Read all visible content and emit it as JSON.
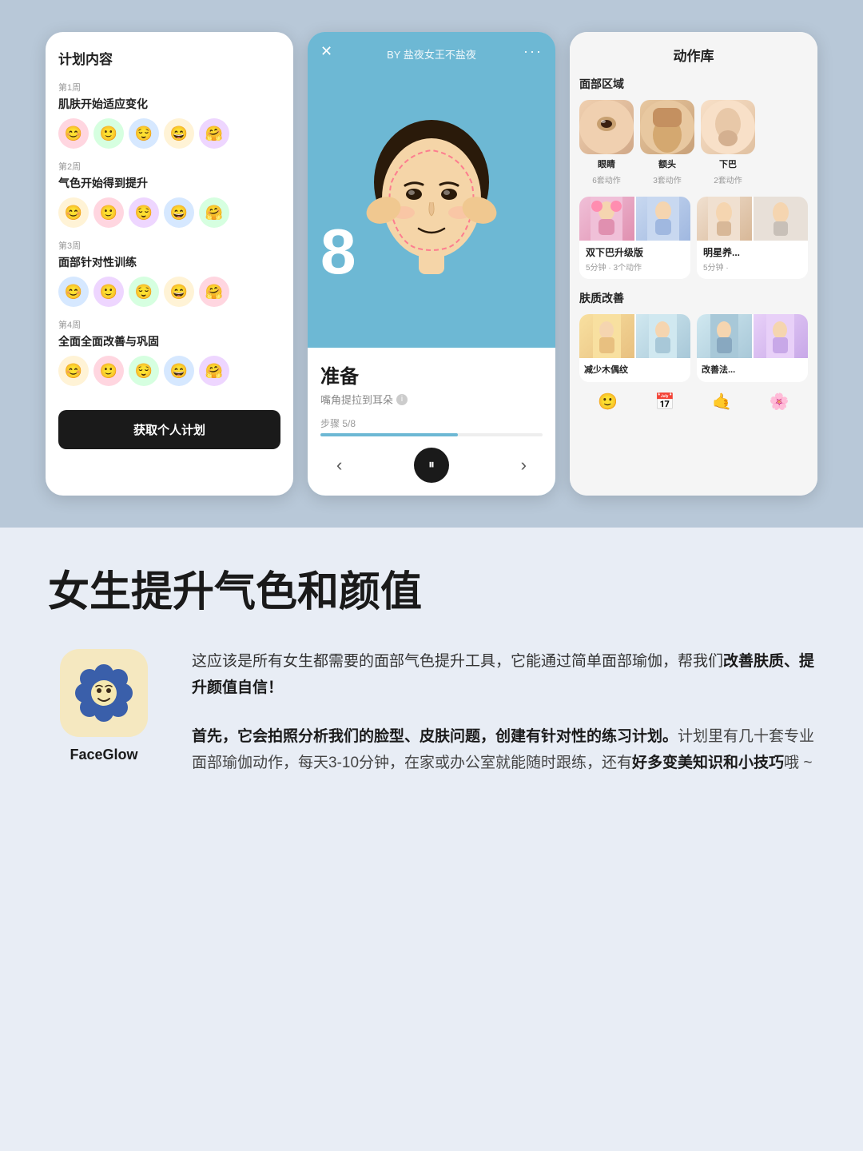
{
  "screenshots": {
    "phone1": {
      "title": "计划内容",
      "weeks": [
        {
          "label": "第1周",
          "title": "肌肤开始适应变化",
          "avatars": [
            "av-pink",
            "av-green",
            "av-blue",
            "av-yellow",
            "av-purple"
          ]
        },
        {
          "label": "第2周",
          "title": "气色开始得到提升",
          "avatars": [
            "av-pink",
            "av-green",
            "av-blue",
            "av-yellow",
            "av-purple"
          ]
        },
        {
          "label": "第3周",
          "title": "面部针对性训练",
          "avatars": [
            "av-blue",
            "av-purple",
            "av-green",
            "av-yellow",
            "av-pink"
          ]
        },
        {
          "label": "第4周",
          "title": "全面全面改善与巩固",
          "avatars": [
            "av-yellow",
            "av-pink",
            "av-green",
            "av-blue",
            "av-purple"
          ]
        }
      ],
      "btn_label": "获取个人计划"
    },
    "phone2": {
      "by_text": "BY 盐夜女王不盐夜",
      "countdown": "8",
      "exercise_name": "准备",
      "exercise_desc": "嘴角提拉到耳朵",
      "step_text": "步骤 5/8",
      "progress_pct": 62
    },
    "phone3": {
      "title": "动作库",
      "section1": "面部区域",
      "areas": [
        {
          "label": "眼睛",
          "count": "6套动作",
          "bg": "photo-eye"
        },
        {
          "label": "额头",
          "count": "3套动作",
          "bg": "photo-forehead"
        },
        {
          "label": "下巴",
          "count": "2套动作",
          "bg": "photo-chin"
        }
      ],
      "action_cards": [
        {
          "title": "双下巴升级版",
          "sub": "5分钟 · 3个动作",
          "img_left": "action-img-left",
          "img_right": "action-img-right"
        },
        {
          "title": "明星养...",
          "sub": "5分钟 ·",
          "img_left": "star-card-img",
          "img_right": "star-card-img"
        }
      ],
      "section2": "肤质改善",
      "skin_cards": [
        {
          "title": "减少木偶纹",
          "img_left": "skin-img1",
          "img_right": "skin-img2"
        },
        {
          "title": "改善法...",
          "img_left": "skin-img2",
          "img_right": "skin-img3"
        }
      ]
    }
  },
  "bottom": {
    "headline": "女生提升气色和颜值",
    "app_icon": "🌸",
    "app_name": "FaceGlow",
    "desc1_plain": "这应该是所有女生都需要的面部气色提升工具，它能通过简单面部瑜伽，帮我们",
    "desc1_bold": "改善肤质、提升颜值自信！",
    "desc2_bold": "首先，它会拍照分析我们的脸型、皮肤问题，创建有针对性的练习计划。",
    "desc2_plain": "计划里有几十套专业面部瑜伽动作，每天3-10分钟，在家或办公室就能随时跟练，还有",
    "desc2_bold2": "好多变美知识和小技巧",
    "desc2_end": "哦 ~"
  }
}
